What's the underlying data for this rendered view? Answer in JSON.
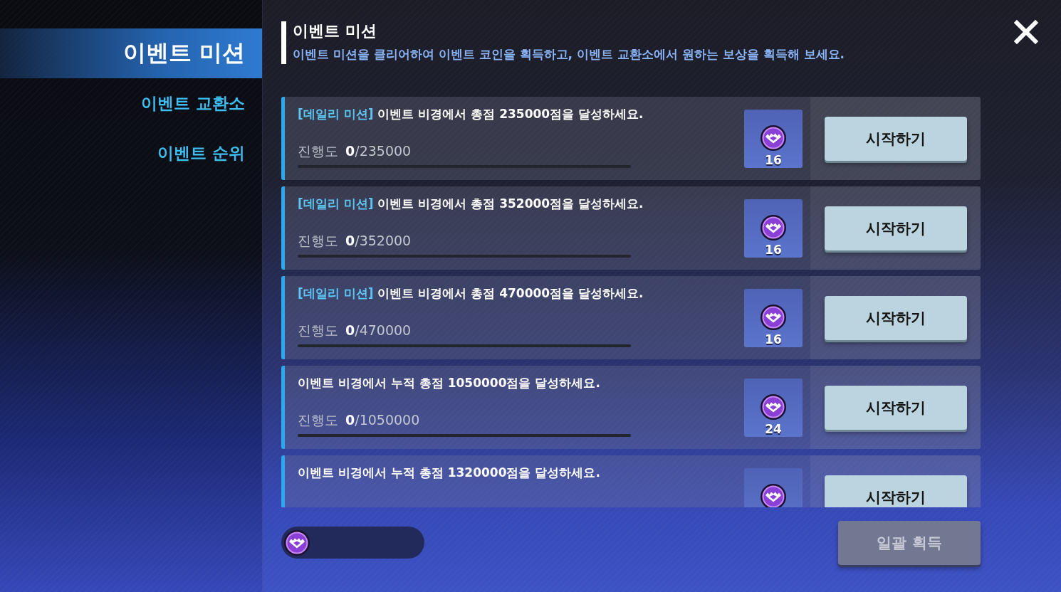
{
  "sidebar": {
    "items": [
      {
        "label": "이벤트 미션",
        "selected": true
      },
      {
        "label": "이벤트 교환소",
        "selected": false
      },
      {
        "label": "이벤트 순위",
        "selected": false
      }
    ]
  },
  "header": {
    "title": "이벤트 미션",
    "description": "이벤트 미션을 클리어하여 이벤트 코인을 획득하고, 이벤트 교환소에서 원하는 보상을 획득해 보세요."
  },
  "missions": [
    {
      "tag": "[데일리 미션]",
      "title": "이벤트 비경에서 총점 235000점을 달성하세요.",
      "progress_label": "진행도",
      "progress": "**0**/235000",
      "reward_count": "16",
      "button": "시작하기"
    },
    {
      "tag": "[데일리 미션]",
      "title": "이벤트 비경에서 총점 352000점을 달성하세요.",
      "progress_label": "진행도",
      "progress": "**0**/352000",
      "reward_count": "16",
      "button": "시작하기"
    },
    {
      "tag": "[데일리 미션]",
      "title": "이벤트 비경에서 총점 470000점을 달성하세요.",
      "progress_label": "진행도",
      "progress": "**0**/470000",
      "reward_count": "16",
      "button": "시작하기"
    },
    {
      "title": "이벤트 비경에서 누적 총점 1050000점을 달성하세요.",
      "progress_label": "진행도",
      "progress": "**0**/1050000",
      "reward_count": "24",
      "button": "시작하기"
    },
    {
      "title": "이벤트 비경에서 누적 총점 1320000점을 달성하세요.",
      "button": "시작하기"
    }
  ],
  "bulk_claim": {
    "label": "일괄 획득",
    "disabled": true
  }
}
